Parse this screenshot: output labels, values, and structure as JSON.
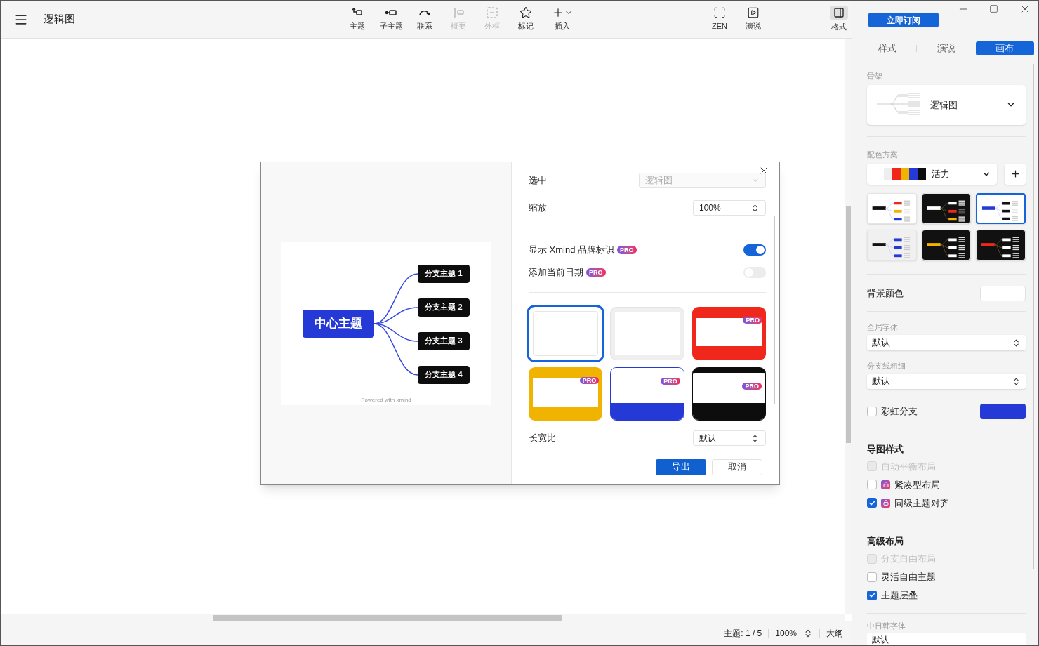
{
  "window": {
    "title": "逻辑图"
  },
  "toolbar": [
    {
      "kind": "topic",
      "label": "主题",
      "disabled": false
    },
    {
      "kind": "subtopic",
      "label": "子主题",
      "disabled": false
    },
    {
      "kind": "relation",
      "label": "联系",
      "disabled": false
    },
    {
      "kind": "summary",
      "label": "概要",
      "disabled": true
    },
    {
      "kind": "boundary",
      "label": "外框",
      "disabled": true
    },
    {
      "kind": "marker",
      "label": "标记",
      "disabled": false
    },
    {
      "kind": "insert",
      "label": "插入",
      "disabled": false
    }
  ],
  "view_tools": [
    {
      "kind": "zen",
      "label": "ZEN"
    },
    {
      "kind": "pitch",
      "label": "演说"
    }
  ],
  "format_toggle": {
    "label": "格式",
    "selected": true
  },
  "subscribe_button": "立即订阅",
  "panel": {
    "tabs": [
      {
        "label": "样式",
        "selected": false
      },
      {
        "label": "演说",
        "selected": false
      },
      {
        "label": "画布",
        "selected": true
      }
    ],
    "skeleton": {
      "label": "骨架",
      "value": "逻辑图"
    },
    "color_scheme": {
      "label": "配色方案",
      "value": "活力",
      "swatches": [
        {
          "color": "#eeeeee"
        },
        {
          "color": "#f0281c"
        },
        {
          "color": "#f0b400"
        },
        {
          "color": "#2439d6"
        },
        {
          "color": "#0d0d0d"
        }
      ],
      "themes": [
        {
          "kind": "light",
          "color": "#111111",
          "branches": [
            {
              "color": "#f0281c"
            },
            {
              "color": "#f0b400"
            },
            {
              "color": "#2439d6"
            }
          ],
          "selected": false
        },
        {
          "kind": "dark",
          "color": "#ffffff",
          "branches": [
            {
              "color": "#ffffff"
            },
            {
              "color": "#f0281c"
            },
            {
              "color": "#f0b400"
            }
          ],
          "selected": false
        },
        {
          "kind": "light",
          "color": "#2439d6",
          "branches": [
            {
              "color": "#111111"
            },
            {
              "color": "#111111"
            },
            {
              "color": "#111111"
            }
          ],
          "selected": true
        },
        {
          "kind": "gray",
          "color": "#111111",
          "branches": [
            {
              "color": "#2439d6"
            },
            {
              "color": "#2439d6"
            },
            {
              "color": "#2439d6"
            }
          ],
          "selected": false
        },
        {
          "kind": "dark",
          "color": "#f0b400",
          "branches": [
            {
              "color": "#ffffff"
            },
            {
              "color": "#ffffff"
            },
            {
              "color": "#ffffff"
            }
          ],
          "selected": false
        },
        {
          "kind": "dark",
          "color": "#f0281c",
          "branches": [
            {
              "color": "#ffffff"
            },
            {
              "color": "#ffffff"
            },
            {
              "color": "#ffffff"
            }
          ],
          "selected": false
        }
      ]
    },
    "background": {
      "label": "背景颜色",
      "color": "#ffffff"
    },
    "global_font": {
      "label": "全局字体",
      "value": "默认"
    },
    "branch_width": {
      "label": "分支线粗细",
      "value": "默认"
    },
    "rainbow": {
      "label": "彩虹分支",
      "checked": false,
      "color": "#2439d6"
    },
    "map_style": {
      "title": "导图样式",
      "options": [
        {
          "label": "自动平衡布局",
          "checked": false,
          "disabled": true,
          "locked": false
        },
        {
          "label": "紧凑型布局",
          "checked": false,
          "disabled": false,
          "locked": true
        },
        {
          "label": "同级主题对齐",
          "checked": true,
          "disabled": false,
          "locked": true
        }
      ]
    },
    "advanced_layout": {
      "title": "高级布局",
      "options": [
        {
          "label": "分支自由布局",
          "checked": false,
          "disabled": true,
          "locked": false
        },
        {
          "label": "灵活自由主题",
          "checked": false,
          "disabled": false,
          "locked": false
        },
        {
          "label": "主题层叠",
          "checked": true,
          "disabled": false,
          "locked": false
        }
      ]
    },
    "cjk_font": {
      "label": "中日韩字体",
      "value": "默认"
    }
  },
  "status_bar": {
    "topics": "主题: 1 / 5",
    "zoom": "100%",
    "outline": "大纲"
  },
  "export_dialog": {
    "preview": {
      "central": "中心主题",
      "branches": [
        "分支主题 1",
        "分支主题 2",
        "分支主题 3",
        "分支主题 4"
      ],
      "footer": "Powered with xmind"
    },
    "selection": {
      "label": "选中",
      "value": "逻辑图",
      "disabled": true
    },
    "zoom": {
      "label": "缩放",
      "value": "100%"
    },
    "toggles": [
      {
        "label": "显示 Xmind 品牌标识",
        "badge": "PRO",
        "on": true
      },
      {
        "label": "添加当前日期",
        "badge": "PRO",
        "on": false
      }
    ],
    "frames": [
      {
        "kind": "inset",
        "color": "#ffffff",
        "selected": true
      },
      {
        "kind": "inset",
        "color": "#efefef",
        "selected": false
      },
      {
        "kind": "inset",
        "color": "#f0281c",
        "badge": "PRO",
        "selected": false
      },
      {
        "kind": "inset",
        "color": "#f0b400",
        "badge": "PRO",
        "selected": false
      },
      {
        "kind": "band",
        "color": "#2439d6",
        "badge": "PRO",
        "selected": false
      },
      {
        "kind": "band",
        "color": "#0d0d0d",
        "badge": "PRO",
        "selected": false
      }
    ],
    "aspect": {
      "label": "长宽比",
      "value": "默认"
    },
    "buttons": [
      {
        "label": "导出",
        "primary": true
      },
      {
        "label": "取消",
        "primary": false
      }
    ]
  }
}
